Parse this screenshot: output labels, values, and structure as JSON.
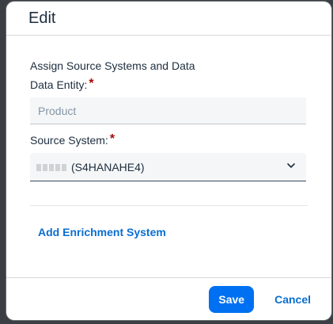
{
  "dialog": {
    "title": "Edit"
  },
  "form": {
    "section_title": "Assign Source Systems and Data",
    "data_entity": {
      "label": "Data Entity:",
      "required_mark": "*",
      "value": "Product"
    },
    "source_system": {
      "label": "Source System:",
      "required_mark": "*",
      "value": "(S4HANAHE4)"
    },
    "add_enrichment_label": "Add Enrichment System"
  },
  "footer": {
    "save_label": "Save",
    "cancel_label": "Cancel"
  },
  "colors": {
    "accent": "#0070f2",
    "link": "#0a6ed1",
    "required": "#aa0808"
  },
  "icons": {
    "select_chevron": "chevron-down-icon"
  }
}
